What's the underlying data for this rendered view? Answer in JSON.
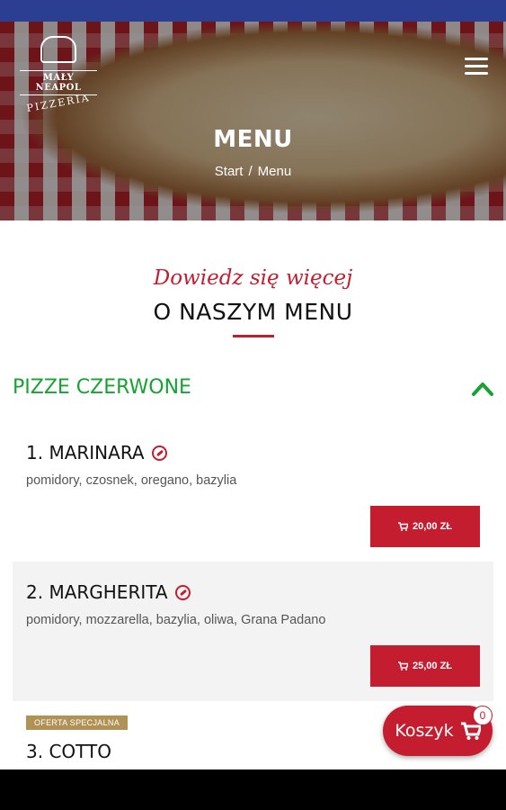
{
  "brand": {
    "name_top": "MAŁY NEAPOL",
    "name_bottom": "PIZZERIA"
  },
  "hero": {
    "title": "MENU",
    "breadcrumb": {
      "home": "Start",
      "separator": "/",
      "current": "Menu"
    }
  },
  "intro": {
    "script": "Dowiedz się więcej",
    "title": "O NASZYM MENU"
  },
  "category": {
    "title": "PIZZE CZERWONE",
    "expanded": true
  },
  "items": [
    {
      "name": "1. MARINARA",
      "description": "pomidory, czosnek, oregano, bazylia",
      "price": "20,00 ZŁ",
      "vegetarian": true
    },
    {
      "name": "2. MARGHERITA",
      "description": "pomidory, mozzarella, bazylia, oliwa, Grana Padano",
      "price": "25,00 ZŁ",
      "vegetarian": true
    },
    {
      "name": "3. COTTO",
      "badge": "OFERTA SPECJALNA"
    }
  ],
  "cart": {
    "label": "Koszyk",
    "count": "0"
  },
  "colors": {
    "accent": "#c31d2f",
    "category": "#16a334",
    "badge": "#b29155",
    "statusbar": "#2c3e91"
  },
  "icons": {
    "menu": "hamburger-icon",
    "chevron": "chevron-up-icon",
    "cart": "cart-icon",
    "veg": "leaf-icon"
  }
}
